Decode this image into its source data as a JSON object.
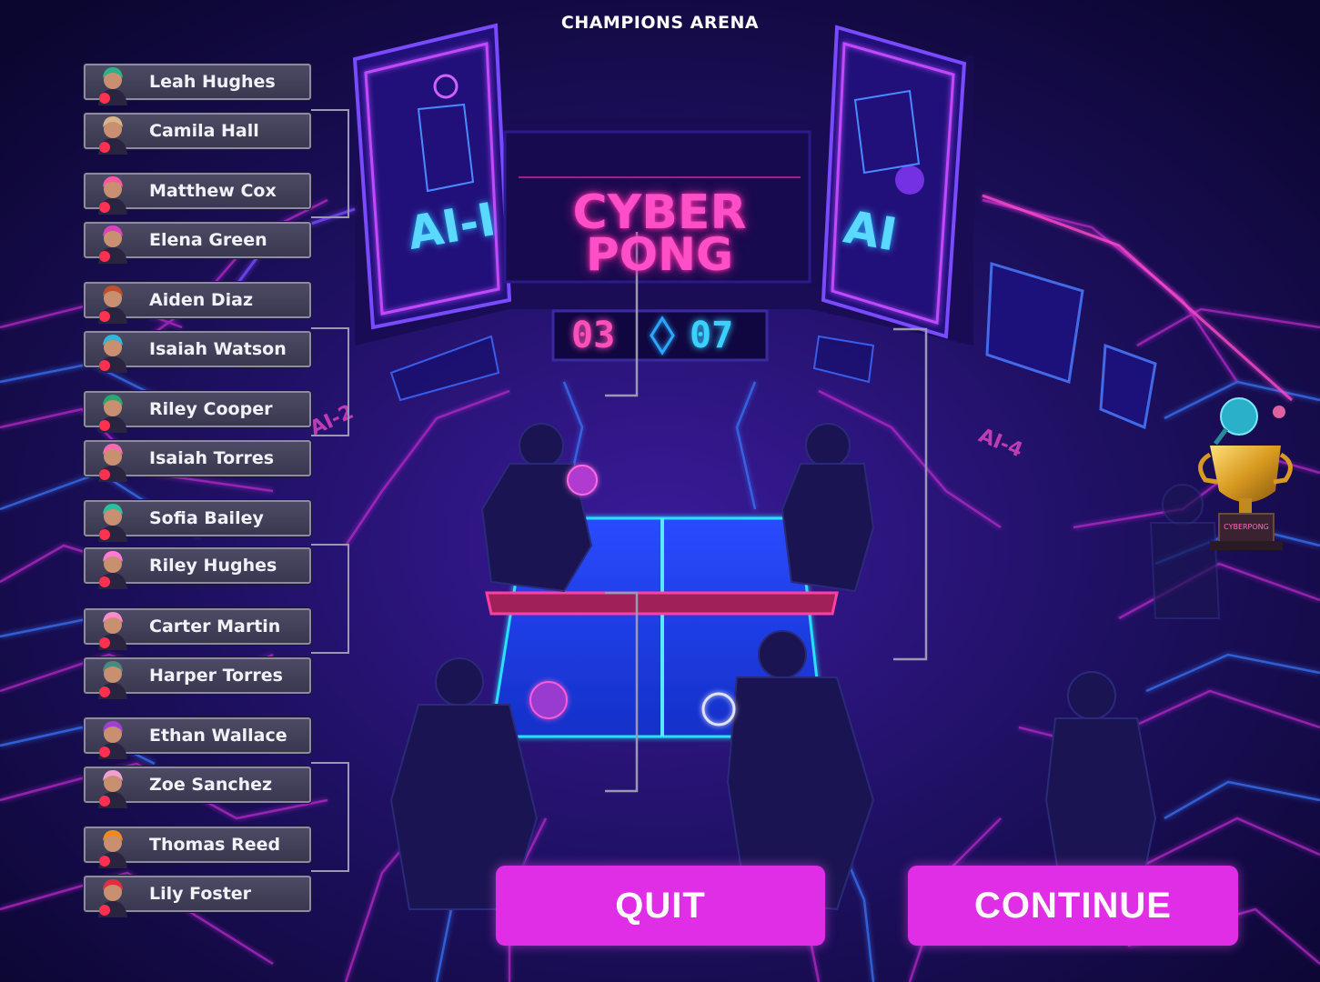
{
  "header": {
    "title": "CHAMPIONS ARENA"
  },
  "arena": {
    "logo_line1": "CYBER",
    "logo_line2": "PONG",
    "score_left": "03",
    "score_right": "07",
    "screen_left": "AI-I",
    "screen_right": "AI",
    "floor_label_left": "AI-2",
    "floor_label_right": "AI-4",
    "trophy_plate": "CYBERPONG"
  },
  "players": [
    {
      "name": "Leah Hughes",
      "avatar_color": "#2ab38a",
      "avatar_accent": "#ff3050"
    },
    {
      "name": "Camila Hall",
      "avatar_color": "#d8b48a",
      "avatar_accent": "#ff3050"
    },
    {
      "name": "Matthew Cox",
      "avatar_color": "#ff5aa0",
      "avatar_accent": "#ff3050"
    },
    {
      "name": "Elena Green",
      "avatar_color": "#e040c0",
      "avatar_accent": "#ff3050"
    },
    {
      "name": "Aiden Diaz",
      "avatar_color": "#c0502a",
      "avatar_accent": "#ff3050"
    },
    {
      "name": "Isaiah Watson",
      "avatar_color": "#30b8d8",
      "avatar_accent": "#ff3050"
    },
    {
      "name": "Riley Cooper",
      "avatar_color": "#2aa870",
      "avatar_accent": "#ff3050"
    },
    {
      "name": "Isaiah Torres",
      "avatar_color": "#ff6ab0",
      "avatar_accent": "#ff3050"
    },
    {
      "name": "Sofia Bailey",
      "avatar_color": "#28c0a0",
      "avatar_accent": "#ff3050"
    },
    {
      "name": "Riley Hughes",
      "avatar_color": "#ff7ad8",
      "avatar_accent": "#ff3050"
    },
    {
      "name": "Carter Martin",
      "avatar_color": "#ff8ac8",
      "avatar_accent": "#ff3050"
    },
    {
      "name": "Harper Torres",
      "avatar_color": "#4a8a80",
      "avatar_accent": "#ff3050"
    },
    {
      "name": "Ethan Wallace",
      "avatar_color": "#a040d0",
      "avatar_accent": "#ff3050"
    },
    {
      "name": "Zoe Sanchez",
      "avatar_color": "#f0a0d0",
      "avatar_accent": "#ff3050"
    },
    {
      "name": "Thomas Reed",
      "avatar_color": "#f08a20",
      "avatar_accent": "#ff3050"
    },
    {
      "name": "Lily Foster",
      "avatar_color": "#e03040",
      "avatar_accent": "#ff3050"
    }
  ],
  "buttons": {
    "quit": "QUIT",
    "continue": "CONTINUE"
  },
  "colors": {
    "background": "#120a3e",
    "button": "#e02ee6",
    "neon_pink": "#ff3fb8",
    "neon_blue": "#2f8cff",
    "table": "#1d3cf0"
  }
}
